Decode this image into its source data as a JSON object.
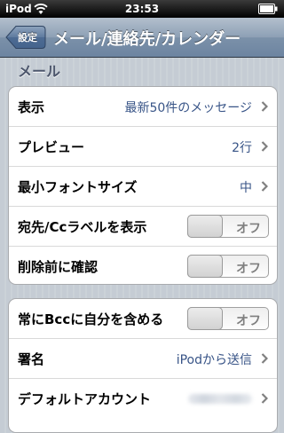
{
  "status_bar": {
    "carrier": "iPod",
    "time": "23:53"
  },
  "nav": {
    "back_label": "設定",
    "title": "メール/連絡先/カレンダー"
  },
  "mail_section": {
    "header": "メール",
    "rows": [
      {
        "label": "表示",
        "value": "最新50件のメッセージ"
      },
      {
        "label": "プレビュー",
        "value": "2行"
      },
      {
        "label": "最小フォントサイズ",
        "value": "中"
      },
      {
        "label": "宛先/Ccラベルを表示",
        "toggle": "オフ"
      },
      {
        "label": "削除前に確認",
        "toggle": "オフ"
      }
    ]
  },
  "account_section": {
    "rows": [
      {
        "label": "常にBccに自分を含める",
        "toggle": "オフ"
      },
      {
        "label": "署名",
        "value": "iPodから送信"
      },
      {
        "label": "デフォルトアカウント"
      }
    ]
  }
}
